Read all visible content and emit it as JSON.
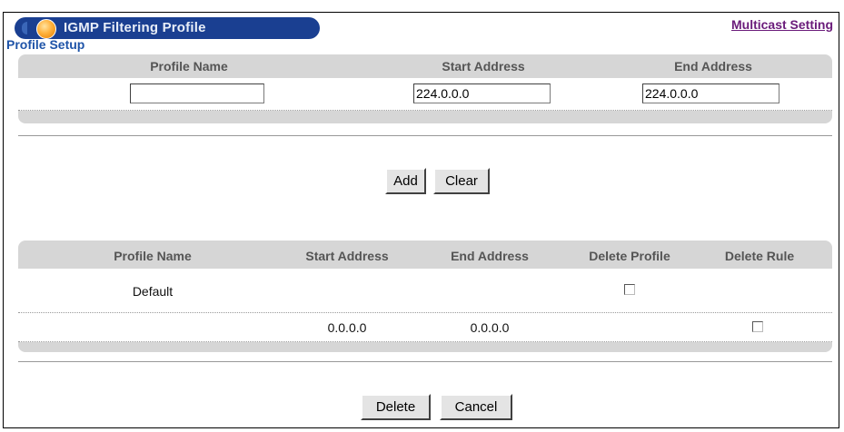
{
  "header": {
    "title": "IGMP Filtering Profile",
    "link_label": "Multicast Setting"
  },
  "profile_setup": {
    "section_title": "Profile Setup",
    "columns": [
      "Profile Name",
      "Start Address",
      "End Address"
    ],
    "profile_name_value": "",
    "start_address_value": "224.0.0.0",
    "end_address_value": "224.0.0.0",
    "add_label": "Add",
    "clear_label": "Clear"
  },
  "profiles_table": {
    "columns": [
      "Profile Name",
      "Start Address",
      "End Address",
      "Delete Profile",
      "Delete Rule"
    ],
    "rows": [
      {
        "profile_name": "Default",
        "start_address": "",
        "end_address": "",
        "delete_profile": false
      },
      {
        "profile_name": "",
        "start_address": "0.0.0.0",
        "end_address": "0.0.0.0",
        "delete_rule": false
      }
    ],
    "delete_label": "Delete",
    "cancel_label": "Cancel"
  },
  "colors": {
    "title_bar": "#1a3f91",
    "section_title": "#1f54a8",
    "link": "#6a1b7a",
    "table_header_bg": "#d6d6d6"
  }
}
